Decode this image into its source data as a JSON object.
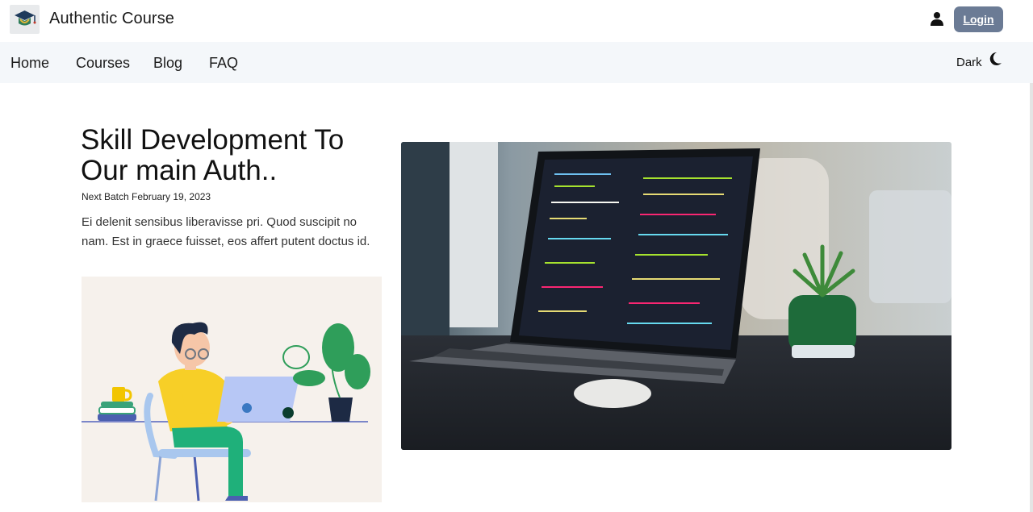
{
  "header": {
    "brand": "Authentic Course",
    "login_label": "Login"
  },
  "nav": {
    "items": [
      "Home",
      "Courses",
      "Blog",
      "FAQ"
    ],
    "theme_label": "Dark"
  },
  "hero": {
    "title": "Skill Development To Our main Auth..",
    "batch": "Next Batch February 19, 2023",
    "description": "Ei delenit sensibus liberavisse pri. Quod suscipit no nam. Est in graece fuisset, eos affert putent doctus id."
  },
  "icons": {
    "logo": "graduation-cap-logo",
    "user": "user-icon",
    "theme": "moon-icon"
  },
  "colors": {
    "login_button": "#6b7b95",
    "nav_background": "#f4f7fa",
    "illustration_background": "#f6f1ec"
  }
}
